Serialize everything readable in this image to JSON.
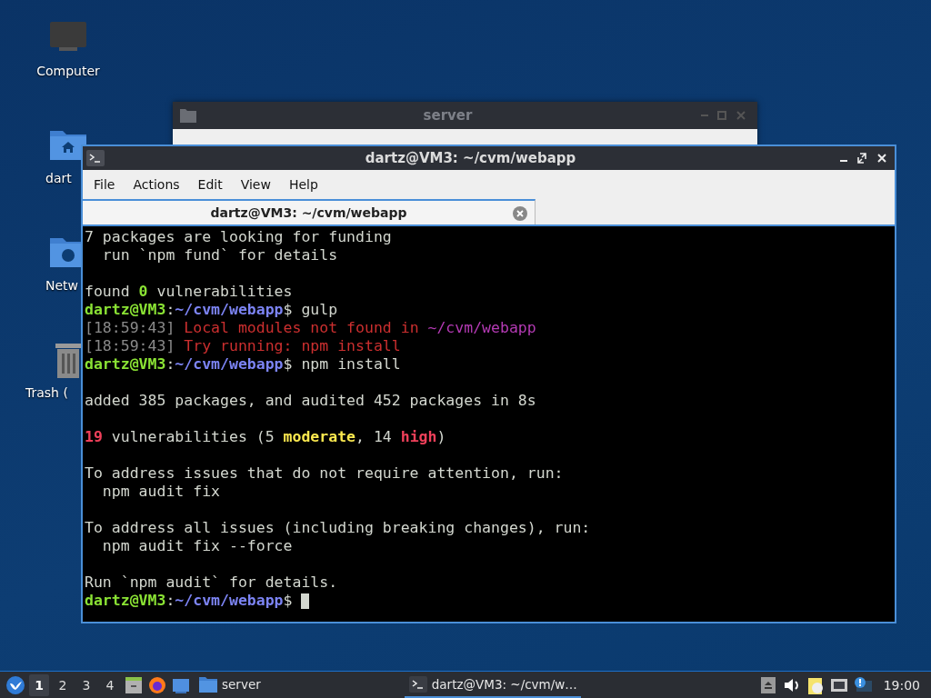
{
  "desktop_icons": [
    {
      "kind": "computer",
      "label": "Computer"
    },
    {
      "kind": "home",
      "label": "dart"
    },
    {
      "kind": "network",
      "label": "Netw"
    },
    {
      "kind": "trash",
      "label": "Trash ("
    }
  ],
  "file_manager_window": {
    "title": "server"
  },
  "terminal_window": {
    "title": "dartz@VM3: ~/cvm/webapp",
    "menu": [
      "File",
      "Actions",
      "Edit",
      "View",
      "Help"
    ],
    "tabs": [
      {
        "label": "dartz@VM3: ~/cvm/webapp",
        "selected": true
      }
    ],
    "blocks": [
      {
        "lines": [
          {
            "segments": [
              {
                "kind": "plain",
                "text": "7 packages are looking for funding"
              }
            ]
          },
          {
            "segments": [
              {
                "kind": "plain",
                "text": "  run `npm fund` for details"
              }
            ]
          }
        ]
      },
      {
        "lines": [
          {
            "segments": [
              {
                "kind": "plain",
                "text": "found "
              },
              {
                "kind": "good",
                "text": "0"
              },
              {
                "kind": "plain",
                "text": " vulnerabilities"
              }
            ]
          },
          {
            "segments": [
              {
                "kind": "user",
                "text": "dartz@VM3"
              },
              {
                "kind": "plain",
                "text": ":"
              },
              {
                "kind": "path",
                "text": "~/cvm/webapp"
              },
              {
                "kind": "plain",
                "text": "$ gulp"
              }
            ]
          },
          {
            "segments": [
              {
                "kind": "stamp",
                "text": "[18:59:43] "
              },
              {
                "kind": "error",
                "text": "Local modules not found in "
              },
              {
                "kind": "error_path",
                "text": "~/cvm/webapp"
              }
            ]
          },
          {
            "segments": [
              {
                "kind": "stamp",
                "text": "[18:59:43] "
              },
              {
                "kind": "error",
                "text": "Try running: npm install"
              }
            ]
          },
          {
            "segments": [
              {
                "kind": "user",
                "text": "dartz@VM3"
              },
              {
                "kind": "plain",
                "text": ":"
              },
              {
                "kind": "path",
                "text": "~/cvm/webapp"
              },
              {
                "kind": "plain",
                "text": "$ npm install"
              }
            ]
          }
        ]
      },
      {
        "lines": [
          {
            "segments": [
              {
                "kind": "plain",
                "text": "added 385 packages, and audited 452 packages in 8s"
              }
            ]
          }
        ]
      },
      {
        "lines": [
          {
            "segments": [
              {
                "kind": "bad",
                "text": "19"
              },
              {
                "kind": "plain",
                "text": " vulnerabilities (5 "
              },
              {
                "kind": "moderate",
                "text": "moderate"
              },
              {
                "kind": "plain",
                "text": ", 14 "
              },
              {
                "kind": "bad",
                "text": "high"
              },
              {
                "kind": "plain",
                "text": ")"
              }
            ]
          }
        ]
      },
      {
        "lines": [
          {
            "segments": [
              {
                "kind": "plain",
                "text": "To address issues that do not require attention, run:"
              }
            ]
          },
          {
            "segments": [
              {
                "kind": "plain",
                "text": "  npm audit fix"
              }
            ]
          }
        ]
      },
      {
        "lines": [
          {
            "segments": [
              {
                "kind": "plain",
                "text": "To address all issues (including breaking changes), run:"
              }
            ]
          },
          {
            "segments": [
              {
                "kind": "plain",
                "text": "  npm audit fix --force"
              }
            ]
          }
        ]
      },
      {
        "lines": [
          {
            "segments": [
              {
                "kind": "plain",
                "text": "Run `npm audit` for details."
              }
            ]
          },
          {
            "cursor": true,
            "segments": [
              {
                "kind": "user",
                "text": "dartz@VM3"
              },
              {
                "kind": "plain",
                "text": ":"
              },
              {
                "kind": "path",
                "text": "~/cvm/webapp"
              },
              {
                "kind": "plain",
                "text": "$ "
              }
            ]
          }
        ]
      }
    ]
  },
  "taskbar": {
    "workspaces": [
      {
        "label": "1",
        "selected": true
      },
      {
        "label": "2",
        "selected": false
      },
      {
        "label": "3",
        "selected": false
      },
      {
        "label": "4",
        "selected": false
      }
    ],
    "tasks": [
      {
        "kind": "folder",
        "label": "server",
        "selected": false
      },
      {
        "kind": "terminal",
        "label": "dartz@VM3: ~/cvm/w…",
        "selected": true
      }
    ],
    "clock": "19:00"
  }
}
